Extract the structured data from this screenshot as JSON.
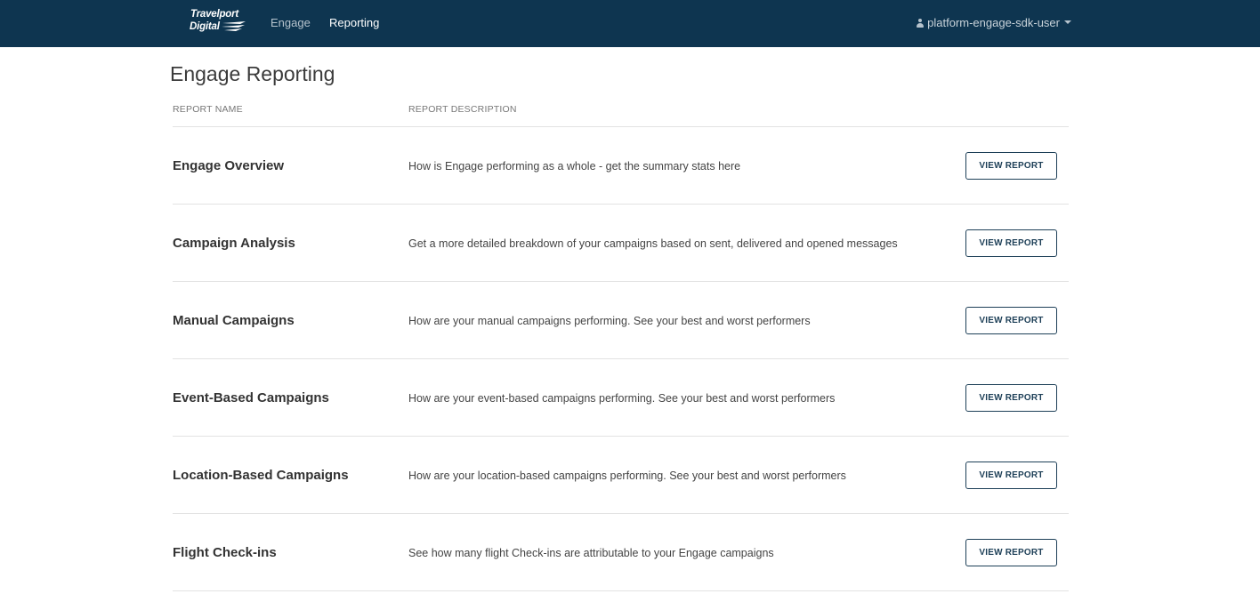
{
  "header": {
    "logo_line1": "Travelport",
    "logo_line2": "Digital",
    "nav": [
      {
        "label": "Engage",
        "active": false
      },
      {
        "label": "Reporting",
        "active": true
      }
    ],
    "user": "platform-engage-sdk-user",
    "colors": {
      "bar": "#0e3550",
      "active_link": "#ffffff",
      "link": "#b6c3cd"
    }
  },
  "page": {
    "title": "Engage Reporting"
  },
  "table": {
    "columns": [
      "REPORT NAME",
      "REPORT DESCRIPTION"
    ],
    "rows": [
      {
        "name": "Engage Overview",
        "description": "How is Engage performing as a whole - get the summary stats here",
        "button": "VIEW REPORT"
      },
      {
        "name": "Campaign Analysis",
        "description": "Get a more detailed breakdown of your campaigns based on sent, delivered and opened messages",
        "button": "VIEW REPORT"
      },
      {
        "name": "Manual Campaigns",
        "description": "How are your manual campaigns performing. See your best and worst performers",
        "button": "VIEW REPORT"
      },
      {
        "name": "Event-Based Campaigns",
        "description": "How are your event-based campaigns performing. See your best and worst performers",
        "button": "VIEW REPORT"
      },
      {
        "name": "Location-Based Campaigns",
        "description": "How are your location-based campaigns performing. See your best and worst performers",
        "button": "VIEW REPORT"
      },
      {
        "name": "Flight Check-ins",
        "description": "See how many flight Check-ins are attributable to your Engage campaigns",
        "button": "VIEW REPORT"
      }
    ]
  }
}
